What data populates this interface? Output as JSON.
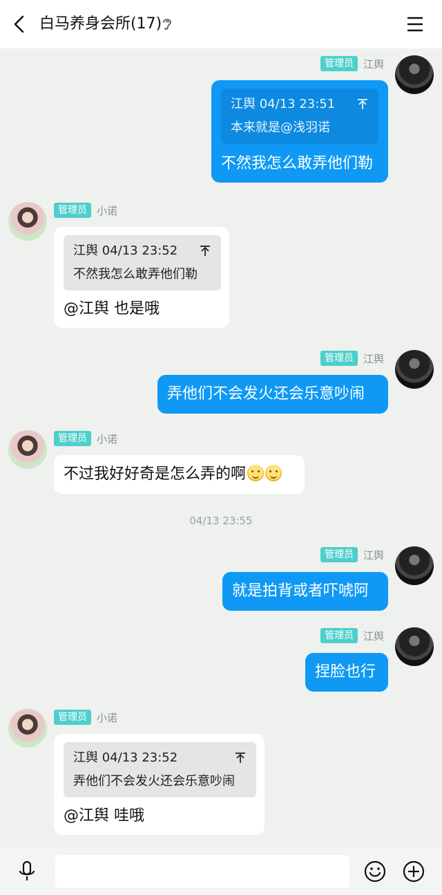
{
  "header": {
    "title": "白马养身会所(17)"
  },
  "messages": [
    {
      "side": "right",
      "badge": "管理员",
      "name": "江舆",
      "quote": {
        "author_time": "江舆 04/13 23:51",
        "text": "本来就是@浅羽诺"
      },
      "text": "不然我怎么敢弄他们勒"
    },
    {
      "side": "left",
      "badge": "管理员",
      "name": "小诺",
      "quote": {
        "author_time": "江舆 04/13 23:52",
        "text": "不然我怎么敢弄他们勒"
      },
      "text": "@江舆 也是哦"
    },
    {
      "side": "right",
      "badge": "管理员",
      "name": "江舆",
      "text": "弄他们不会发火还会乐意吵闹"
    },
    {
      "side": "left",
      "badge": "管理员",
      "name": "小诺",
      "text": "不过我好好奇是怎么弄的啊"
    },
    {
      "separator": "04/13 23:55"
    },
    {
      "side": "right",
      "badge": "管理员",
      "name": "江舆",
      "text": "就是拍背或者吓唬阿"
    },
    {
      "side": "right",
      "badge": "管理员",
      "name": "江舆",
      "text": "捏脸也行"
    },
    {
      "side": "left",
      "badge": "管理员",
      "name": "小诺",
      "quote": {
        "author_time": "江舆 04/13 23:52",
        "text": "弄他们不会发火还会乐意吵闹"
      },
      "text": "@江舆 哇哦"
    }
  ],
  "input": {
    "placeholder": ""
  },
  "colors": {
    "outgoing_bubble": "#0f99f4",
    "incoming_bubble": "#ffffff",
    "admin_badge": "#4ecfcb",
    "background": "#eef1ee"
  }
}
